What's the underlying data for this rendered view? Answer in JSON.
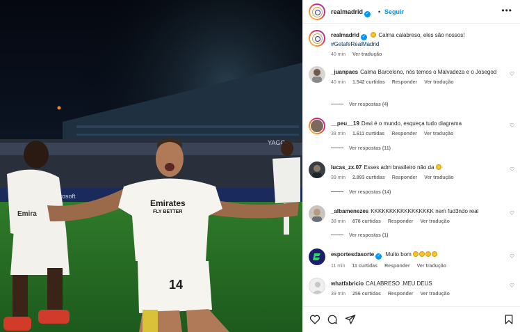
{
  "header": {
    "username": "realmadrid",
    "verified_mark": "✓",
    "separator": "•",
    "follow_label": "Seguir",
    "more_label": "•••"
  },
  "caption": {
    "username": "realmadrid",
    "text": "Calma calabreso, eles são nossos!",
    "hashtag": "#GetafeRealMadrid",
    "time": "40 min",
    "translate_label": "Ver tradução"
  },
  "photo": {
    "shirt_sponsor_line1": "Emirates",
    "shirt_sponsor_line2": "FLY BETTER",
    "shirt_number": "14",
    "left_player_sponsor": "Emira",
    "board_text_1": "Microsoft",
    "board_text_2": "YAGO"
  },
  "comments": [
    {
      "username": "_juanpaes",
      "text": "Calma Barcelono, nós temos o Malvadeza e o Josegod",
      "time": "40 min",
      "likes": "1.542 curtidas",
      "reply_label": "Responder",
      "translate_label": "Ver tradução",
      "replies_label": "Ver respostas (4)"
    },
    {
      "username": "__peu__19",
      "text": "Davi é o mundo, esqueça tudo diagrama",
      "time": "38 min",
      "likes": "1.611 curtidas",
      "reply_label": "Responder",
      "translate_label": "Ver tradução",
      "replies_label": "Ver respostas (11)"
    },
    {
      "username": "lucas_zx.07",
      "text": "Esses adm brasileiro não da",
      "time": "39 min",
      "likes": "2.893 curtidas",
      "reply_label": "Responder",
      "translate_label": "Ver tradução",
      "replies_label": "Ver respostas (14)"
    },
    {
      "username": "_albamenezes",
      "text": "KKKKKKKKKKKKKKKKK nem fud3ndo real",
      "time": "38 min",
      "likes": "878 curtidas",
      "reply_label": "Responder",
      "translate_label": "Ver tradução",
      "replies_label": "Ver respostas (1)"
    },
    {
      "username": "esportesdasorte",
      "text": "Muito bom",
      "time": "11 min",
      "likes": "11 curtidas",
      "reply_label": "Responder",
      "translate_label": "Ver tradução"
    },
    {
      "username": "whatfabricio",
      "text": "CALABRESO .MEU DEUS",
      "time": "39 min",
      "likes": "256 curtidas",
      "reply_label": "Responder",
      "translate_label": "Ver tradução"
    }
  ],
  "icons": {
    "like": "heart-icon",
    "comment": "comment-icon",
    "share": "share-icon",
    "save": "bookmark-icon",
    "comment_like": "♡"
  },
  "colors": {
    "accent": "#0095f6",
    "meta": "#737373",
    "hashtag": "#00376b"
  }
}
